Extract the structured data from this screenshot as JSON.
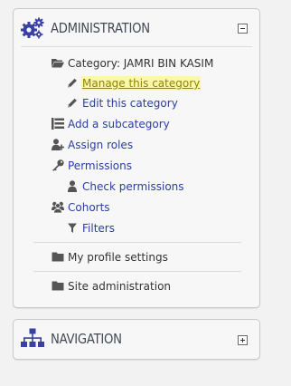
{
  "admin_block": {
    "title": "ADMINISTRATION",
    "header_icon": "gears-icon",
    "toggle_icon": "collapse-minus-icon",
    "items": [
      {
        "label": "Category: JAMRI BIN KASIM",
        "icon": "folder-open-icon",
        "style": "plain"
      },
      {
        "label": "Manage this category",
        "icon": "pencil-icon",
        "style": "active"
      },
      {
        "label": "Edit this category",
        "icon": "pencil-icon",
        "style": "link"
      },
      {
        "label": "Add a subcategory",
        "icon": "list-icon",
        "style": "link"
      },
      {
        "label": "Assign roles",
        "icon": "user-plus-icon",
        "style": "link"
      },
      {
        "label": "Permissions",
        "icon": "key-icon",
        "style": "link"
      },
      {
        "label": "Check permissions",
        "icon": "user-icon",
        "style": "link"
      },
      {
        "label": "Cohorts",
        "icon": "users-icon",
        "style": "link"
      },
      {
        "label": "Filters",
        "icon": "filter-icon",
        "style": "link"
      },
      {
        "label": "My profile settings",
        "icon": "folder-icon",
        "style": "plain"
      },
      {
        "label": "Site administration",
        "icon": "folder-icon",
        "style": "plain"
      }
    ]
  },
  "nav_block": {
    "title": "NAVIGATION",
    "header_icon": "sitemap-icon",
    "toggle_icon": "expand-plus-icon"
  },
  "colors": {
    "link": "#2a3ea0",
    "header_text": "#434a55",
    "header_icon": "#3a3fa5",
    "active_highlight": "#fbf7ab",
    "active_text": "#8c8600"
  }
}
